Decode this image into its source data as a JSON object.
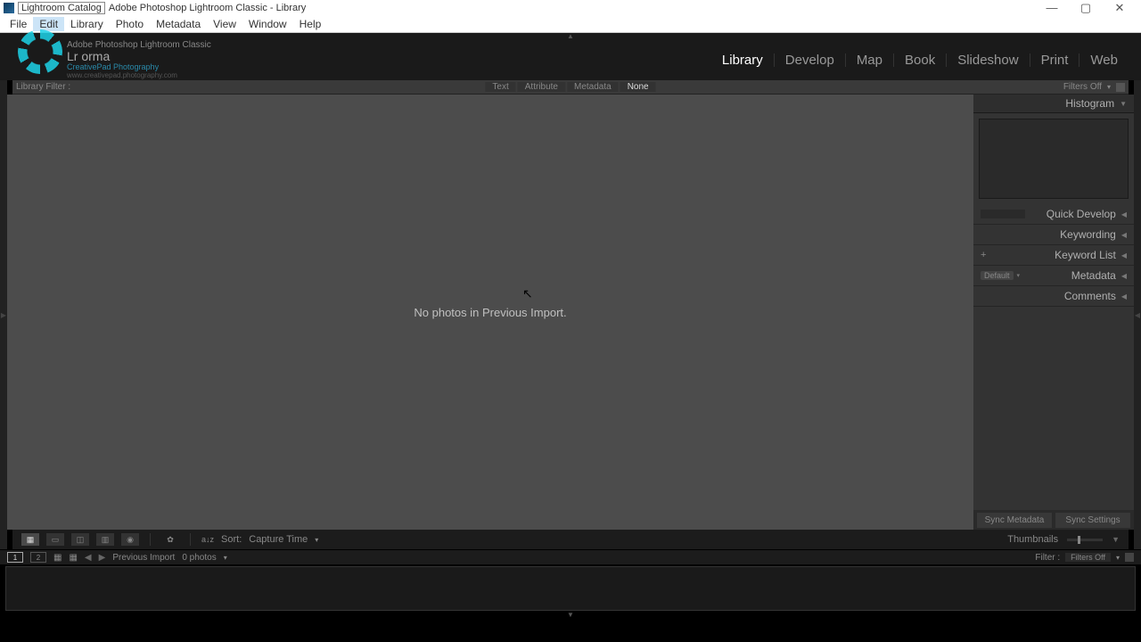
{
  "title": {
    "catalog": "Lightroom Catalog",
    "app": "Adobe Photoshop Lightroom Classic - Library"
  },
  "menubar": [
    "File",
    "Edit",
    "Library",
    "Photo",
    "Metadata",
    "View",
    "Window",
    "Help"
  ],
  "identity": {
    "line1": "Adobe Photoshop Lightroom Classic",
    "line2": "Lr   orma",
    "line3": "CreativePad Photography",
    "line4": "www.creativepad.photography.com"
  },
  "modules": [
    "Library",
    "Develop",
    "Map",
    "Book",
    "Slideshow",
    "Print",
    "Web"
  ],
  "filterbar": {
    "label": "Library Filter :",
    "tabs": [
      "Text",
      "Attribute",
      "Metadata",
      "None"
    ],
    "filters_off": "Filters Off"
  },
  "center": {
    "empty_msg": "No photos in Previous Import."
  },
  "right_panel": {
    "histogram": "Histogram",
    "sections": [
      {
        "name": "Quick Develop",
        "prefix_pill": true
      },
      {
        "name": "Keywording"
      },
      {
        "name": "Keyword List",
        "plus": true
      },
      {
        "name": "Metadata",
        "default_pill": "Default"
      },
      {
        "name": "Comments"
      }
    ]
  },
  "toolbar": {
    "sort_label": "Sort:",
    "sort_value": "Capture Time",
    "thumbnails": "Thumbnails",
    "sync_metadata": "Sync Metadata",
    "sync_settings": "Sync Settings"
  },
  "filmstrip_header": {
    "source": "Previous Import",
    "count": "0 photos",
    "filter_label": "Filter :",
    "filter_value": "Filters Off"
  }
}
